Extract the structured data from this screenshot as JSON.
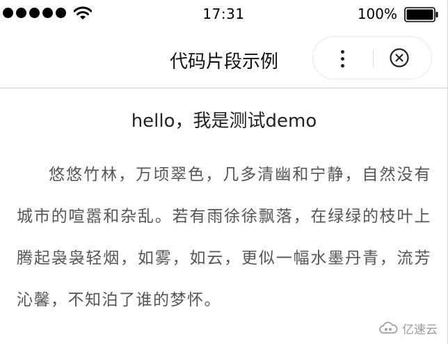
{
  "status_bar": {
    "time": "17:31",
    "battery_percent": "100%",
    "signal_bars": 5,
    "battery_level": 1.0
  },
  "nav_bar": {
    "title": "代码片段示例",
    "menu_icon": "more-dots-icon",
    "close_icon": "close-circle-icon"
  },
  "content": {
    "title": "hello，我是测试demo",
    "paragraph": "悠悠竹林，万顷翠色，几多清幽和宁静，自然没有城市的喧嚣和杂乱。若有雨徐徐飘落，在绿绿的枝叶上腾起袅袅轻烟，如雾，如云，更似一幅水墨丹青，流芳沁馨，不知泊了谁的梦怀。"
  },
  "watermark": {
    "text": "亿速云",
    "icon": "cloud-logo-icon"
  }
}
